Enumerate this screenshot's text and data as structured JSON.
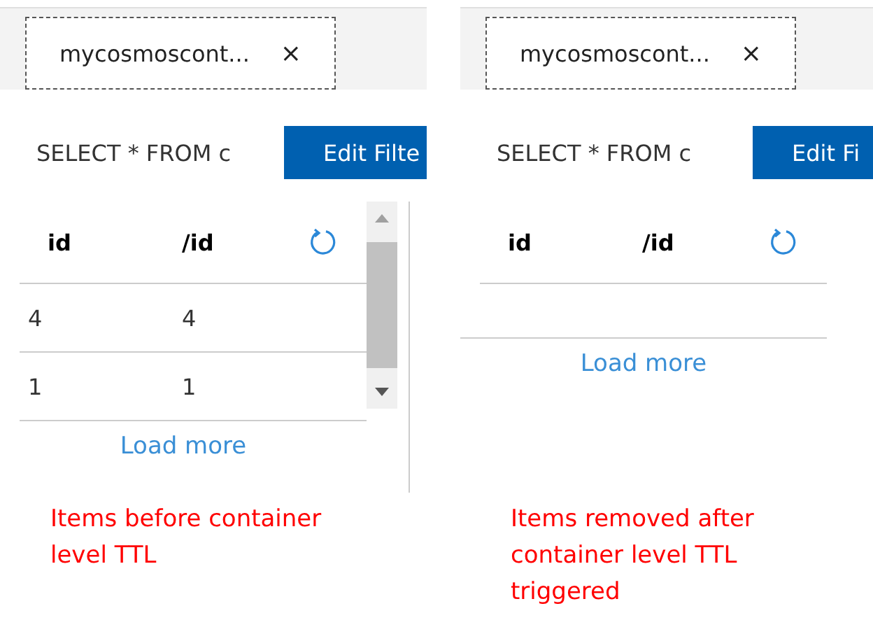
{
  "panels": [
    {
      "tab": {
        "title": "mycosmoscont...",
        "close": "×",
        "selected": true
      },
      "query": "SELECT * FROM c",
      "filter_button": "Edit Filte",
      "columns": [
        "id",
        "/id"
      ],
      "rows": [
        [
          "4",
          "4"
        ],
        [
          "1",
          "1"
        ]
      ],
      "scrollbar": true,
      "load_more": "Load more",
      "caption": "Items before container level TTL"
    },
    {
      "tab": {
        "title": "mycosmoscont...",
        "close": "×",
        "selected": true
      },
      "query": "SELECT * FROM c",
      "filter_button": "Edit Fi",
      "columns": [
        "id",
        "/id"
      ],
      "scrollbar": false,
      "load_more": "Load more",
      "caption": "Items removed after container level TTL triggered"
    }
  ]
}
